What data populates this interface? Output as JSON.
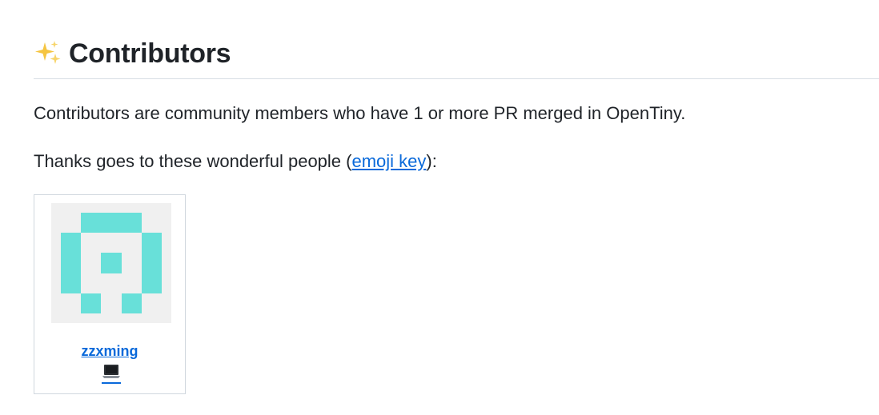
{
  "header": {
    "icon": "sparkles-icon",
    "title": "Contributors"
  },
  "intro": {
    "description": "Contributors are community members who have 1 or more PR merged in OpenTiny.",
    "thanks_prefix": "Thanks goes to these wonderful people (",
    "thanks_link": "emoji key",
    "thanks_suffix": "):"
  },
  "contributors": [
    {
      "username": "zzxming",
      "contribution_icon": "laptop-icon",
      "avatar_color": "#68e0d9"
    }
  ],
  "colors": {
    "link": "#0969da",
    "text": "#1f2328",
    "sparkle": "#f5c542",
    "avatar_bg": "#f0f0f0",
    "avatar_fg": "#68e0d9"
  }
}
